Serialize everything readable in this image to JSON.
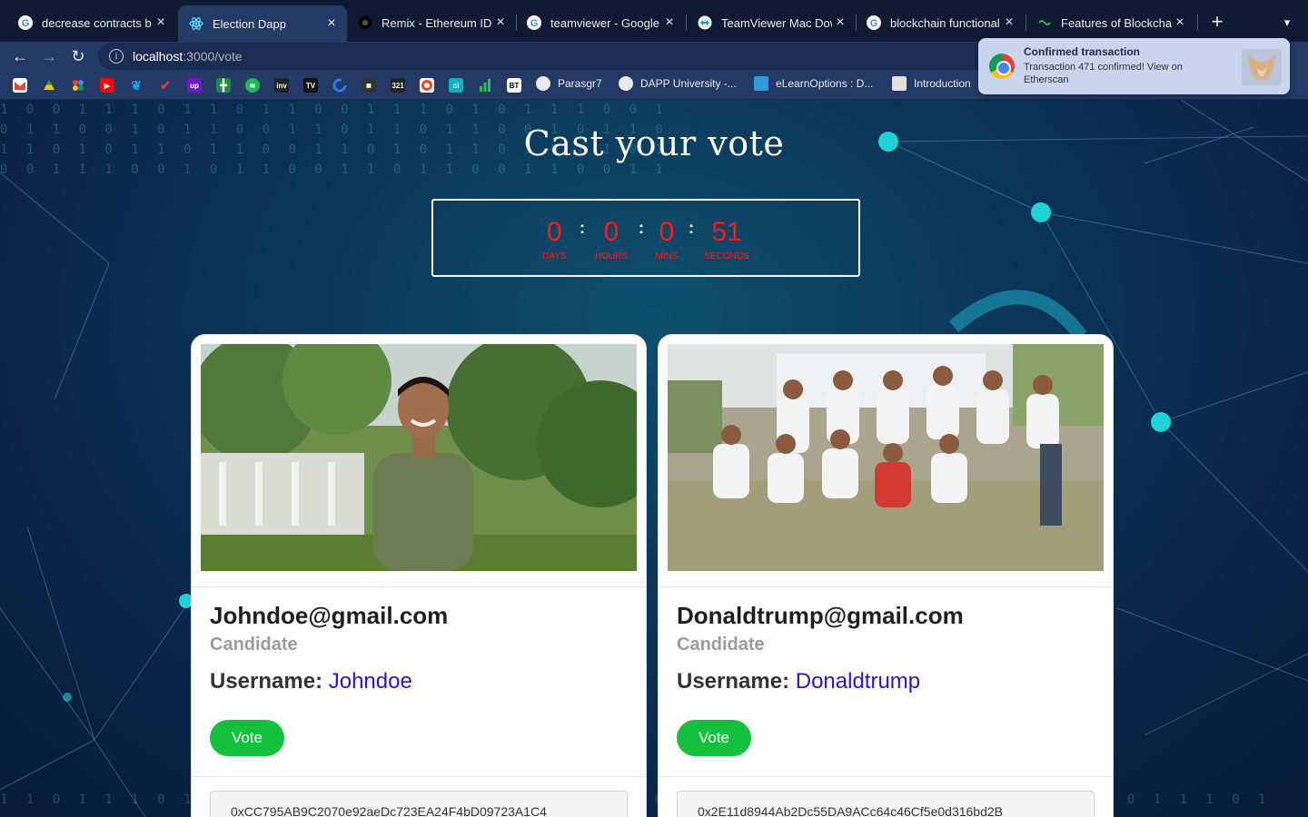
{
  "browser": {
    "tabs": [
      {
        "title": "decrease contracts b",
        "favicon": "google-icon"
      },
      {
        "title": "Election Dapp",
        "favicon": "react-icon",
        "active": true
      },
      {
        "title": "Remix - Ethereum IDE",
        "favicon": "remix-icon"
      },
      {
        "title": "teamviewer - Google",
        "favicon": "google-icon"
      },
      {
        "title": "TeamViewer Mac Dow",
        "favicon": "teamviewer-icon"
      },
      {
        "title": "blockchain functional",
        "favicon": "google-icon"
      },
      {
        "title": "Features of Blockchai",
        "favicon": "blockchain-icon"
      }
    ],
    "url_host": "localhost",
    "url_path": ":3000/vote",
    "bookmarks": [
      {
        "label": "Parasgr7",
        "icon": "github-icon"
      },
      {
        "label": "DAPP University -...",
        "icon": "github-icon"
      },
      {
        "label": "eLearnOptions : D...",
        "icon": "elearn-icon"
      },
      {
        "label": "Introduction",
        "icon": "doc-icon"
      }
    ],
    "bookmark_icon_labels": [
      "up",
      "inv",
      "TV",
      "BT",
      "ci",
      "321"
    ]
  },
  "notification": {
    "title": "Confirmed transaction",
    "body": "Transaction 471 confirmed! View on Etherscan"
  },
  "page": {
    "title": "Cast your vote",
    "timer": {
      "days": "0",
      "days_label": "DAYS",
      "hours": "0",
      "hours_label": "HOURS",
      "mins": "0",
      "mins_label": "MINS",
      "seconds": "51",
      "seconds_label": "SECONDS",
      "color": "#ff1a1a"
    },
    "candidates": [
      {
        "email": "Johndoe@gmail.com",
        "role": "Candidate",
        "username_label": "Username: ",
        "username": "Johndoe",
        "vote_label": "Vote",
        "address": "0xCC795AB9C2070e92aeDc723EA24F4bD09723A1C4"
      },
      {
        "email": "Donaldtrump@gmail.com",
        "role": "Candidate",
        "username_label": "Username: ",
        "username": "Donaldtrump",
        "vote_label": "Vote",
        "address": "0x2E11d8944Ab2Dc55DA9ACc64c46Cf5e0d316bd2B"
      }
    ],
    "vote_button_color": "#13c13d",
    "username_color": "#2a14c7"
  }
}
